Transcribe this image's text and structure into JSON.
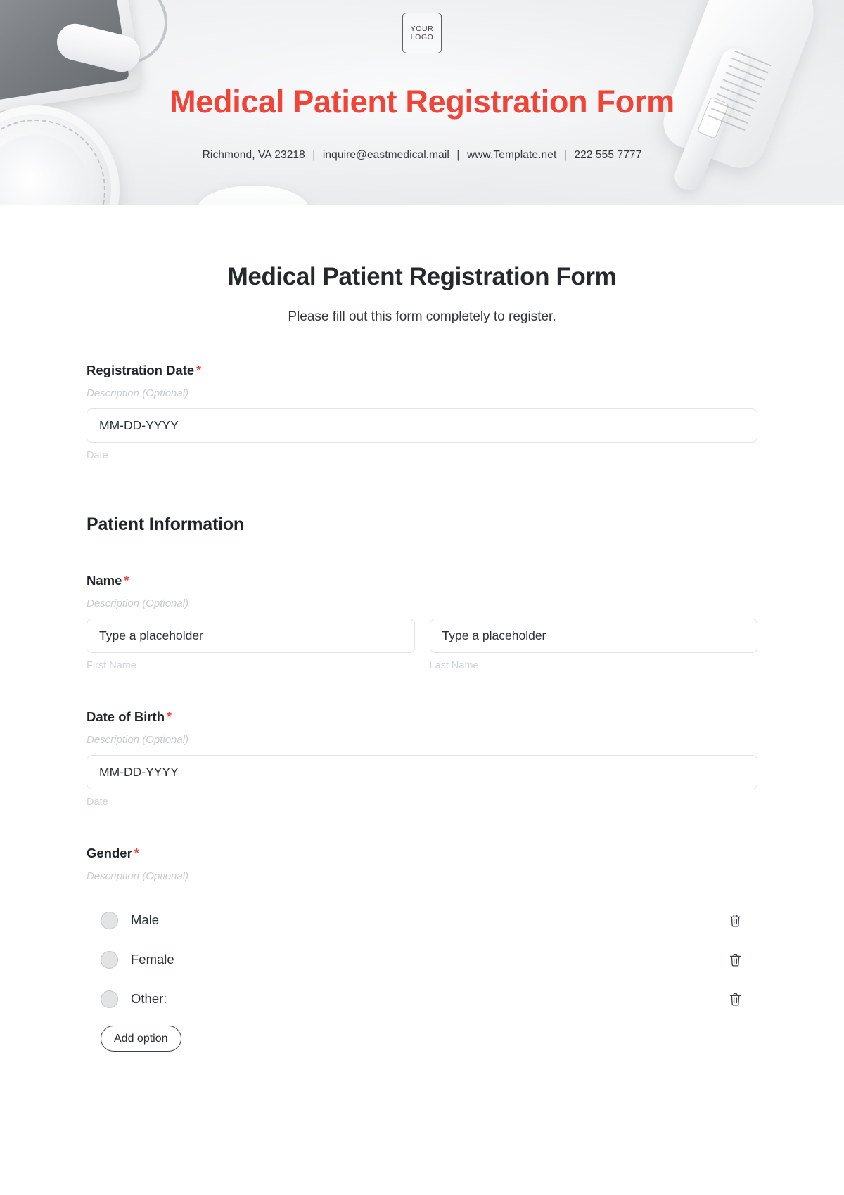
{
  "banner": {
    "logo_line1": "YOUR",
    "logo_line2": "LOGO",
    "title": "Medical Patient Registration Form",
    "contact_address": "Richmond, VA 23218",
    "contact_email": "inquire@eastmedical.mail",
    "contact_website": "www.Template.net",
    "contact_phone": "222 555 7777",
    "separator": "|",
    "title_color": "#f04438"
  },
  "form": {
    "title": "Medical Patient Registration Form",
    "subtitle": "Please fill out this form completely to register.",
    "required_marker": "*",
    "description_placeholder": "Description (Optional)"
  },
  "fields": {
    "registration_date": {
      "label": "Registration Date",
      "description": "Description (Optional)",
      "value": "MM-DD-YYYY",
      "hint": "Date"
    },
    "name": {
      "label": "Name",
      "description": "Description (Optional)",
      "first": {
        "value": "Type a placeholder",
        "hint": "First Name"
      },
      "last": {
        "value": "Type a placeholder",
        "hint": "Last Name"
      }
    },
    "date_of_birth": {
      "label": "Date of Birth",
      "description": "Description (Optional)",
      "value": "MM-DD-YYYY",
      "hint": "Date"
    },
    "gender": {
      "label": "Gender",
      "description": "Description (Optional)",
      "options": [
        {
          "label": "Male"
        },
        {
          "label": "Female"
        },
        {
          "label": "Other:"
        }
      ],
      "add_option_label": "Add option"
    }
  },
  "sections": {
    "patient_information": "Patient Information"
  }
}
